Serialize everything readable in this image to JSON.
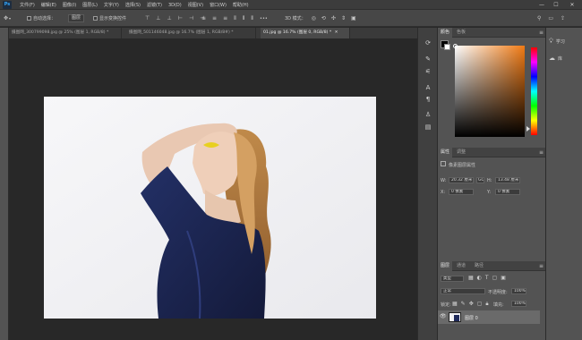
{
  "app": {
    "logo": "Ps"
  },
  "menu": [
    "文件(F)",
    "编辑(E)",
    "图像(I)",
    "图层(L)",
    "文字(Y)",
    "选择(S)",
    "滤镜(T)",
    "3D(D)",
    "视图(V)",
    "窗口(W)",
    "帮助(H)"
  ],
  "window_controls": {
    "minimize": "—",
    "maximize": "☐",
    "close": "✕"
  },
  "options": {
    "auto_select_label": "自动选择：",
    "auto_select_value": "图层",
    "show_transform_label": "显示变换控件",
    "more": "•••",
    "mode_3d": "3D 模式："
  },
  "tabs": [
    {
      "label": "摄图网_300799098.jpg @ 25% (图层 1, RGB/8) *"
    },
    {
      "label": "摄图网_501146048.jpg @ 16.7% (图层 1, RGB/8#) *"
    },
    {
      "label": "01.jpg @ 16.7% (图层 0, RGB/8) *",
      "close": "✕"
    }
  ],
  "color_panel": {
    "tabs": [
      "颜色",
      "色板"
    ]
  },
  "properties_panel": {
    "tabs": [
      "属性",
      "调整"
    ],
    "section": "像素图层属性",
    "w_label": "W:",
    "w_value": "20.32 厘米",
    "link": "GO",
    "h_label": "H:",
    "h_value": "13.48 厘米",
    "x_label": "X:",
    "x_value": "0 像素",
    "y_label": "Y:",
    "y_value": "0 像素"
  },
  "layers_panel": {
    "tabs": [
      "图层",
      "通道",
      "路径"
    ],
    "kind_value": "类型",
    "blend_mode": "正常",
    "opacity_label": "不透明度:",
    "opacity_value": "100%",
    "lock_label": "锁定:",
    "fill_label": "填充:",
    "fill_value": "100%",
    "layer_name": "图层 0"
  },
  "right_dock": [
    {
      "label": "学习"
    },
    {
      "label": "库"
    }
  ],
  "colors": {
    "accent": "#31a8ff",
    "hue_top": "#ff0000",
    "picked": "#f07a14"
  }
}
